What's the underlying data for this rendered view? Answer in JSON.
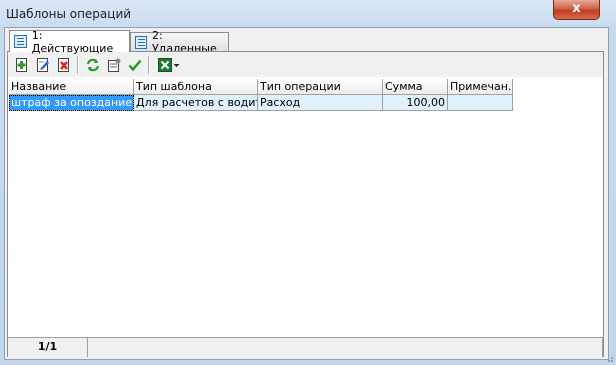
{
  "window": {
    "title": "Шаблоны операций",
    "close_label": "x"
  },
  "tabs": [
    {
      "label": "1: Действующие",
      "icon": "list-icon",
      "active": true
    },
    {
      "label": "2: Удаленные",
      "icon": "list-icon",
      "active": false
    }
  ],
  "toolbar": {
    "buttons": [
      "add-icon",
      "edit-icon",
      "delete-icon",
      "refresh-icon",
      "properties-icon",
      "checkmark-icon",
      "excel-export-icon"
    ]
  },
  "table": {
    "columns": [
      "Название",
      "Тип шаблона",
      "Тип операции",
      "Сумма",
      "Примечан..."
    ],
    "rows": [
      [
        "штраф за опоздание ...",
        "Для расчетов с водит...",
        "Расход",
        "100,00",
        ""
      ]
    ]
  },
  "status": {
    "page": "1/1"
  },
  "colors": {
    "selection": "#3399ff",
    "row_highlight": "#dff1fb",
    "close": "#c43b1f"
  }
}
